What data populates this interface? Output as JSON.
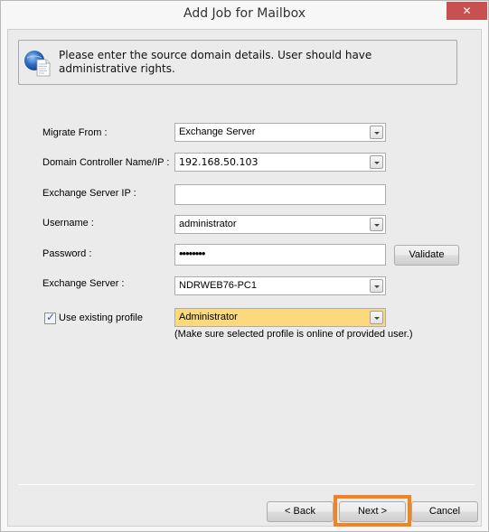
{
  "window": {
    "title": "Add Job for Mailbox",
    "close_label": "✕"
  },
  "info": {
    "icon": "globe-document-icon",
    "text": "Please enter the source domain details. User should have administrative rights."
  },
  "form": {
    "migrate_from": {
      "label": "Migrate From :",
      "value": "Exchange Server"
    },
    "domain_controller": {
      "label": "Domain Controller Name/IP :",
      "value": "192.168.50.103"
    },
    "exchange_server_ip": {
      "label": "Exchange Server IP :",
      "value": ""
    },
    "username": {
      "label": "Username :",
      "value": "administrator"
    },
    "password": {
      "label": "Password :",
      "value": "••••••••"
    },
    "validate_label": "Validate",
    "exchange_server": {
      "label": "Exchange Server :",
      "value": "NDRWEB76-PC1"
    },
    "use_existing_profile": {
      "label": "Use existing profile",
      "checked": true,
      "value": "Administrator"
    },
    "profile_note": "(Make sure selected profile is online of provided user.)"
  },
  "footer": {
    "back_label": "< Back",
    "next_label": "Next >",
    "cancel_label": "Cancel",
    "highlight_color": "#f58220"
  }
}
